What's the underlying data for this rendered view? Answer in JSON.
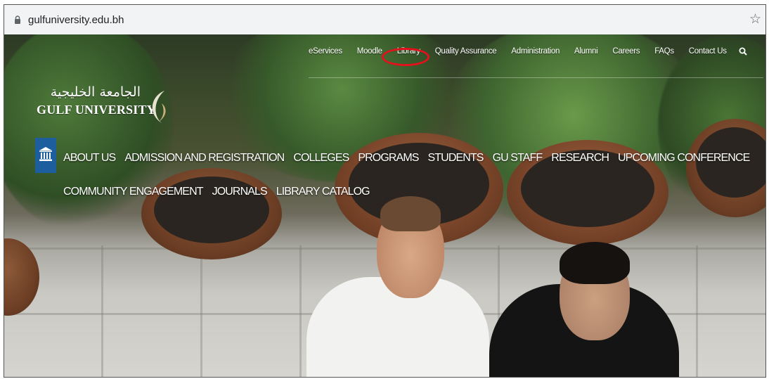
{
  "browser": {
    "url": "gulfuniversity.edu.bh"
  },
  "topnav": {
    "items": [
      "eServices",
      "Moodle",
      "Library",
      "Quality Assurance",
      "Administration",
      "Alumni",
      "Careers",
      "FAQs",
      "Contact Us"
    ]
  },
  "logo": {
    "arabic": "الجامعة الخليجية",
    "english": "GULF UNIVERSITY"
  },
  "mainnav": {
    "row1": [
      "ABOUT US",
      "ADMISSION AND REGISTRATION",
      "COLLEGES",
      "PROGRAMS",
      "STUDENTS",
      "GU STAFF",
      "RESEARCH",
      "UPCOMING CONFERENCE"
    ],
    "row2": [
      "COMMUNITY ENGAGEMENT",
      "JOURNALS",
      "LIBRARY CATALOG"
    ]
  },
  "colors": {
    "highlight": "#e3111b",
    "home_tile": "#1d5f9e"
  }
}
